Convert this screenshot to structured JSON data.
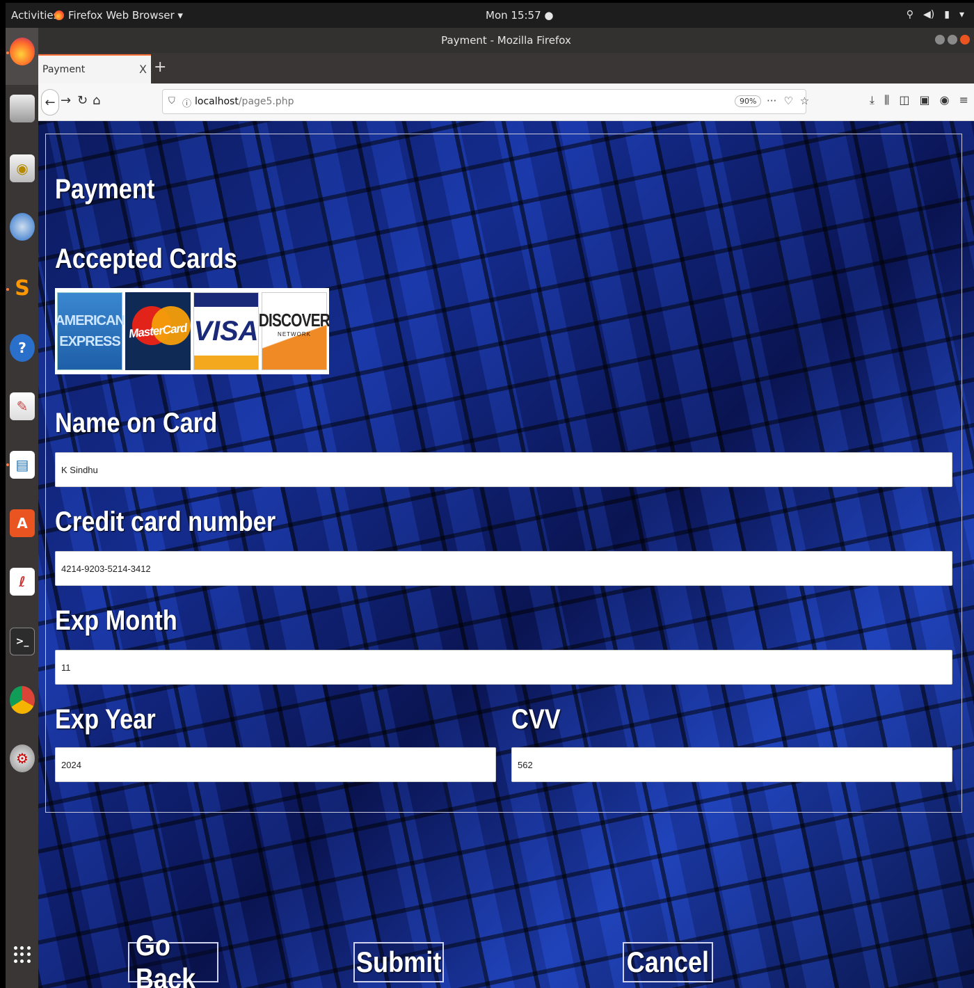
{
  "topbar": {
    "activities": "Activities",
    "app_menu": "Firefox Web Browser ▾",
    "clock": "Mon 15:57 ●"
  },
  "window": {
    "title": "Payment - Mozilla Firefox"
  },
  "tab": {
    "label": "Payment",
    "close": "X",
    "new_tab": "+"
  },
  "urlbar": {
    "host": "localhost",
    "path": "/page5.php",
    "zoom": "90%",
    "more": "···"
  },
  "page": {
    "title": "Payment",
    "accepted_cards": "Accepted Cards",
    "cards": {
      "amex_line1": "AMERICAN",
      "amex_line2": "EXPRESS",
      "mastercard": "MasterCard",
      "visa": "VISA",
      "discover": "DISCOVER",
      "discover_sub": "NETWORK"
    },
    "name_label": "Name on Card",
    "name_value": "K Sindhu",
    "card_number_label": "Credit card number",
    "card_number_value": "4214-9203-5214-3412",
    "exp_month_label": "Exp Month",
    "exp_month_value": "11",
    "exp_year_label": "Exp Year",
    "exp_year_value": "2024",
    "cvv_label": "CVV",
    "cvv_value": "562",
    "go_back": "Go Back",
    "submit": "Submit",
    "cancel": "Cancel"
  },
  "colors": {
    "accent": "#ff7139",
    "ubuntu_orange": "#e95420",
    "background": "#0c1b5e"
  }
}
